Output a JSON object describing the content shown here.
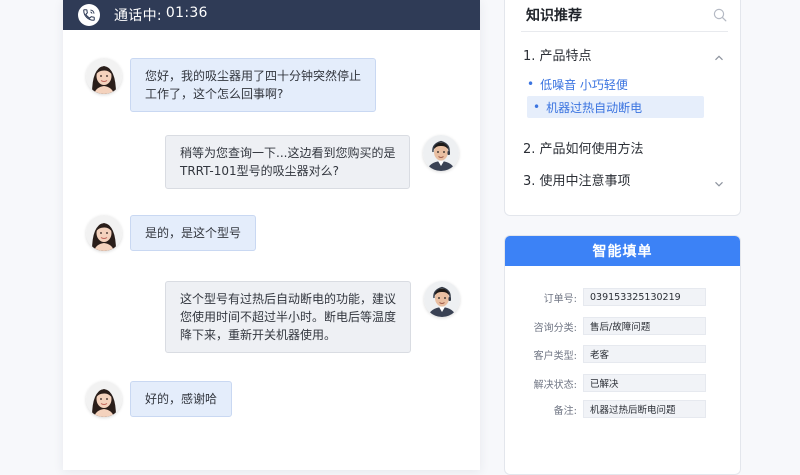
{
  "call": {
    "status_label": "通话中:",
    "timer": "01:36"
  },
  "messages": [
    {
      "role": "customer",
      "text": "您好，我的吸尘器用了四十分钟突然停止\n工作了，这个怎么回事啊?"
    },
    {
      "role": "agent",
      "text": "稍等为您查询一下...这边看到您购买的是\nTRRT-101型号的吸尘器对么?"
    },
    {
      "role": "customer",
      "text": "是的，是这个型号"
    },
    {
      "role": "agent",
      "text": "这个型号有过热后自动断电的功能，建议\n您使用时间不超过半小时。断电后等温度\n降下来，重新开关机器使用。"
    },
    {
      "role": "customer",
      "text": "好的，感谢哈"
    }
  ],
  "knowledge": {
    "title": "知识推荐",
    "sections": [
      {
        "label": "1. 产品特点",
        "expanded": true,
        "items": [
          "低噪音 小巧轻便",
          "机器过热自动断电"
        ]
      },
      {
        "label": "2. 产品如何使用方法",
        "expanded": false,
        "items": []
      },
      {
        "label": "3. 使用中注意事项",
        "expanded": false,
        "items": []
      }
    ],
    "active_item": "机器过热自动断电"
  },
  "form": {
    "title": "智能填单",
    "fields": [
      {
        "label": "订单号:",
        "value": "039153325130219"
      },
      {
        "label": "咨询分类:",
        "value": "售后/故障问题"
      },
      {
        "label": "客户类型:",
        "value": "老客"
      },
      {
        "label": "解决状态:",
        "value": "已解决"
      },
      {
        "label": "备注:",
        "value": "机器过热后断电问题"
      }
    ]
  },
  "colors": {
    "header_dark": "#2f3b56",
    "accent_blue": "#3c82f6",
    "customer_bubble": "#e4edfb",
    "agent_bubble": "#eef0f4",
    "link_blue": "#3b74e0"
  },
  "icons": {
    "call": "phone-icon",
    "search": "search-icon",
    "chevron_up": "chevron-up-icon",
    "chevron_down": "chevron-down-icon"
  }
}
